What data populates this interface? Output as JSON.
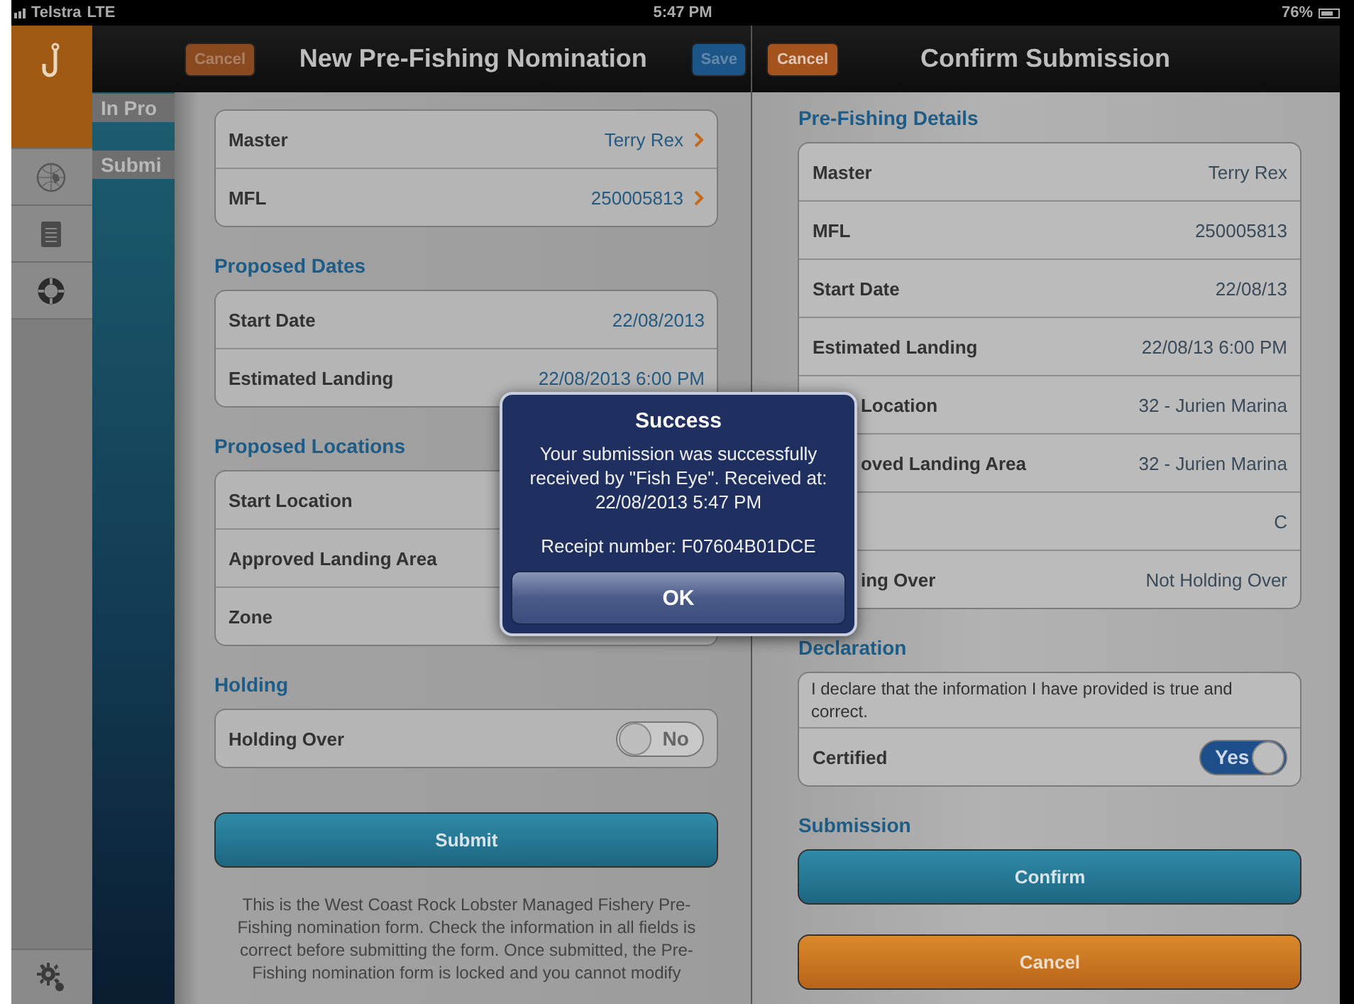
{
  "status_bar": {
    "carrier": "Telstra",
    "network": "LTE",
    "time": "5:47 PM",
    "battery": "76%"
  },
  "rail_items": [
    {
      "selected": true
    },
    {
      "selected": false
    },
    {
      "selected": false
    },
    {
      "selected": false
    }
  ],
  "list_column": {
    "items": [
      {
        "label": "In Pro"
      },
      {
        "label": "Submi"
      }
    ]
  },
  "left_panel": {
    "nav": {
      "left_button": {
        "label": "Cancel",
        "kind": "cancel",
        "disabled": true
      },
      "title": "New Pre-Fishing Nomination",
      "right_button": {
        "label": "Save",
        "kind": "save",
        "disabled": true
      }
    },
    "sections": [
      {
        "rows": [
          {
            "kind": "value",
            "label": "Master",
            "value": "Terry Rex",
            "chevron": true
          },
          {
            "kind": "value",
            "label": "MFL",
            "value": "250005813",
            "chevron": true
          }
        ]
      },
      {
        "heading": "Proposed Dates",
        "rows": [
          {
            "kind": "value",
            "label": "Start Date",
            "value": "22/08/2013"
          },
          {
            "kind": "value",
            "label": "Estimated Landing",
            "value": "22/08/2013 6:00 PM"
          }
        ]
      },
      {
        "heading": "Proposed Locations",
        "rows": [
          {
            "kind": "value",
            "label": "Start Location"
          },
          {
            "kind": "value",
            "label": "Approved Landing Area"
          },
          {
            "kind": "value",
            "label": "Zone"
          }
        ]
      },
      {
        "heading": "Holding",
        "rows": [
          {
            "kind": "toggle",
            "label": "Holding Over",
            "on": false,
            "text": "No"
          }
        ]
      },
      {
        "buttons": [
          {
            "label": "Submit",
            "kind": "primary"
          }
        ]
      }
    ],
    "note": "This is the West Coast Rock Lobster Managed Fishery Pre-Fishing nomination form. Check the information in all fields is correct before submitting the form. Once submitted, the Pre-Fishing nomination form is locked and you cannot modify"
  },
  "right_panel": {
    "nav": {
      "left_button": {
        "label": "Cancel",
        "kind": "cancel",
        "disabled": false
      },
      "title": "Confirm Submission"
    },
    "sections": [
      {
        "heading": "Pre-Fishing Details",
        "rows": [
          {
            "kind": "value",
            "label": "Master",
            "value": "Terry Rex"
          },
          {
            "kind": "value",
            "label": "MFL",
            "value": "250005813"
          },
          {
            "kind": "value",
            "label": "Start Date",
            "value": "22/08/13"
          },
          {
            "kind": "value",
            "label": "Estimated Landing",
            "value": "22/08/13 6:00 PM"
          },
          {
            "kind": "covered",
            "label": "Location",
            "value": "32 - Jurien Marina"
          },
          {
            "kind": "covered",
            "label": "oved Landing Area",
            "value": "32 - Jurien Marina"
          },
          {
            "kind": "covered",
            "value": "C"
          },
          {
            "kind": "covered",
            "label": "ing Over",
            "value": "Not Holding Over"
          }
        ]
      },
      {
        "heading": "Declaration",
        "rows": [
          {
            "kind": "text",
            "text": "I declare that the information I have provided is true and correct."
          },
          {
            "kind": "toggle",
            "label": "Certified",
            "on": true,
            "text": "Yes"
          }
        ]
      },
      {
        "heading": "Submission",
        "buttons": [
          {
            "label": "Confirm",
            "kind": "primary"
          },
          {
            "label": "Cancel",
            "kind": "danger"
          }
        ]
      }
    ]
  },
  "alert": {
    "title": "Success",
    "message": "Your submission was successfully received by \"Fish Eye\". Received at: 22/08/2013 5:47 PM",
    "receipt": "Receipt number: F07604B01DCE",
    "button": "OK"
  }
}
